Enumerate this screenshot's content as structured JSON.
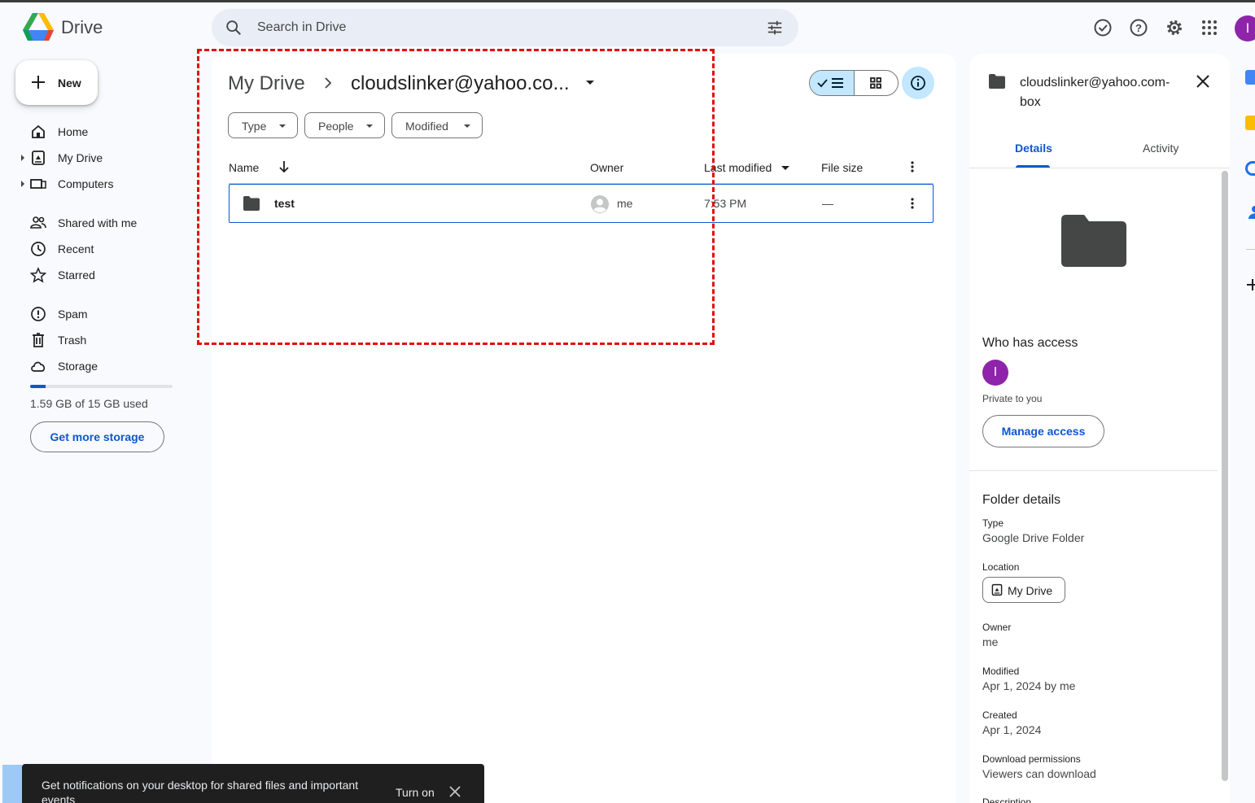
{
  "header": {
    "app_name": "Drive",
    "search_placeholder": "Search in Drive"
  },
  "sidebar": {
    "new_label": "New",
    "items": [
      {
        "label": "Home"
      },
      {
        "label": "My Drive"
      },
      {
        "label": "Computers"
      },
      {
        "label": "Shared with me"
      },
      {
        "label": "Recent"
      },
      {
        "label": "Starred"
      },
      {
        "label": "Spam"
      },
      {
        "label": "Trash"
      },
      {
        "label": "Storage"
      }
    ],
    "storage_used_fraction": 0.106,
    "storage_text": "1.59 GB of 15 GB used",
    "get_more_storage": "Get more storage"
  },
  "main": {
    "breadcrumb_root": "My Drive",
    "breadcrumb_current": "cloudslinker@yahoo.co...",
    "filters": [
      {
        "label": "Type"
      },
      {
        "label": "People"
      },
      {
        "label": "Modified"
      }
    ],
    "columns": {
      "name": "Name",
      "owner": "Owner",
      "last_modified": "Last modified",
      "file_size": "File size"
    },
    "rows": [
      {
        "name": "test",
        "owner": "me",
        "modified": "7:53 PM",
        "size": "—"
      }
    ]
  },
  "details": {
    "title": "cloudslinker@yahoo.com-box",
    "tabs": [
      "Details",
      "Activity"
    ],
    "who_has_access": "Who has access",
    "avatar_letter": "I",
    "private_text": "Private to you",
    "manage_access": "Manage access",
    "folder_details": "Folder details",
    "type_label": "Type",
    "type_value": "Google Drive Folder",
    "location_label": "Location",
    "location_value": "My Drive",
    "owner_label": "Owner",
    "owner_value": "me",
    "modified_label": "Modified",
    "modified_value": "Apr 1, 2024 by me",
    "created_label": "Created",
    "created_value": "Apr 1, 2024",
    "download_label": "Download permissions",
    "download_value": "Viewers can download",
    "description_label": "Description"
  },
  "user": {
    "avatar_letter": "I"
  },
  "snackbar": {
    "text": "Get notifications on your desktop for shared files and important events",
    "action": "Turn on"
  },
  "colors": {
    "accent": "#0b57d0",
    "selected_bg": "#c2e7ff",
    "avatar": "#8e24aa",
    "annotation": "#e01010"
  }
}
